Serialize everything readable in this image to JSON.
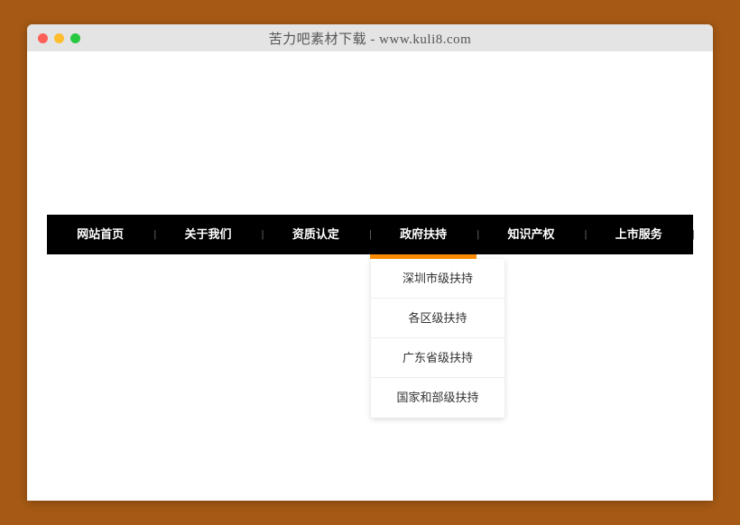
{
  "window": {
    "title": "苦力吧素材下载 - www.kuli8.com"
  },
  "nav": {
    "items": [
      {
        "label": "网站首页",
        "active": false
      },
      {
        "label": "关于我们",
        "active": false
      },
      {
        "label": "资质认定",
        "active": false
      },
      {
        "label": "政府扶持",
        "active": true
      },
      {
        "label": "知识产权",
        "active": false
      },
      {
        "label": "上市服务",
        "active": false
      }
    ]
  },
  "dropdown": {
    "items": [
      {
        "label": "深圳市级扶持"
      },
      {
        "label": "各区级扶持"
      },
      {
        "label": "广东省级扶持"
      },
      {
        "label": "国家和部级扶持"
      }
    ]
  }
}
